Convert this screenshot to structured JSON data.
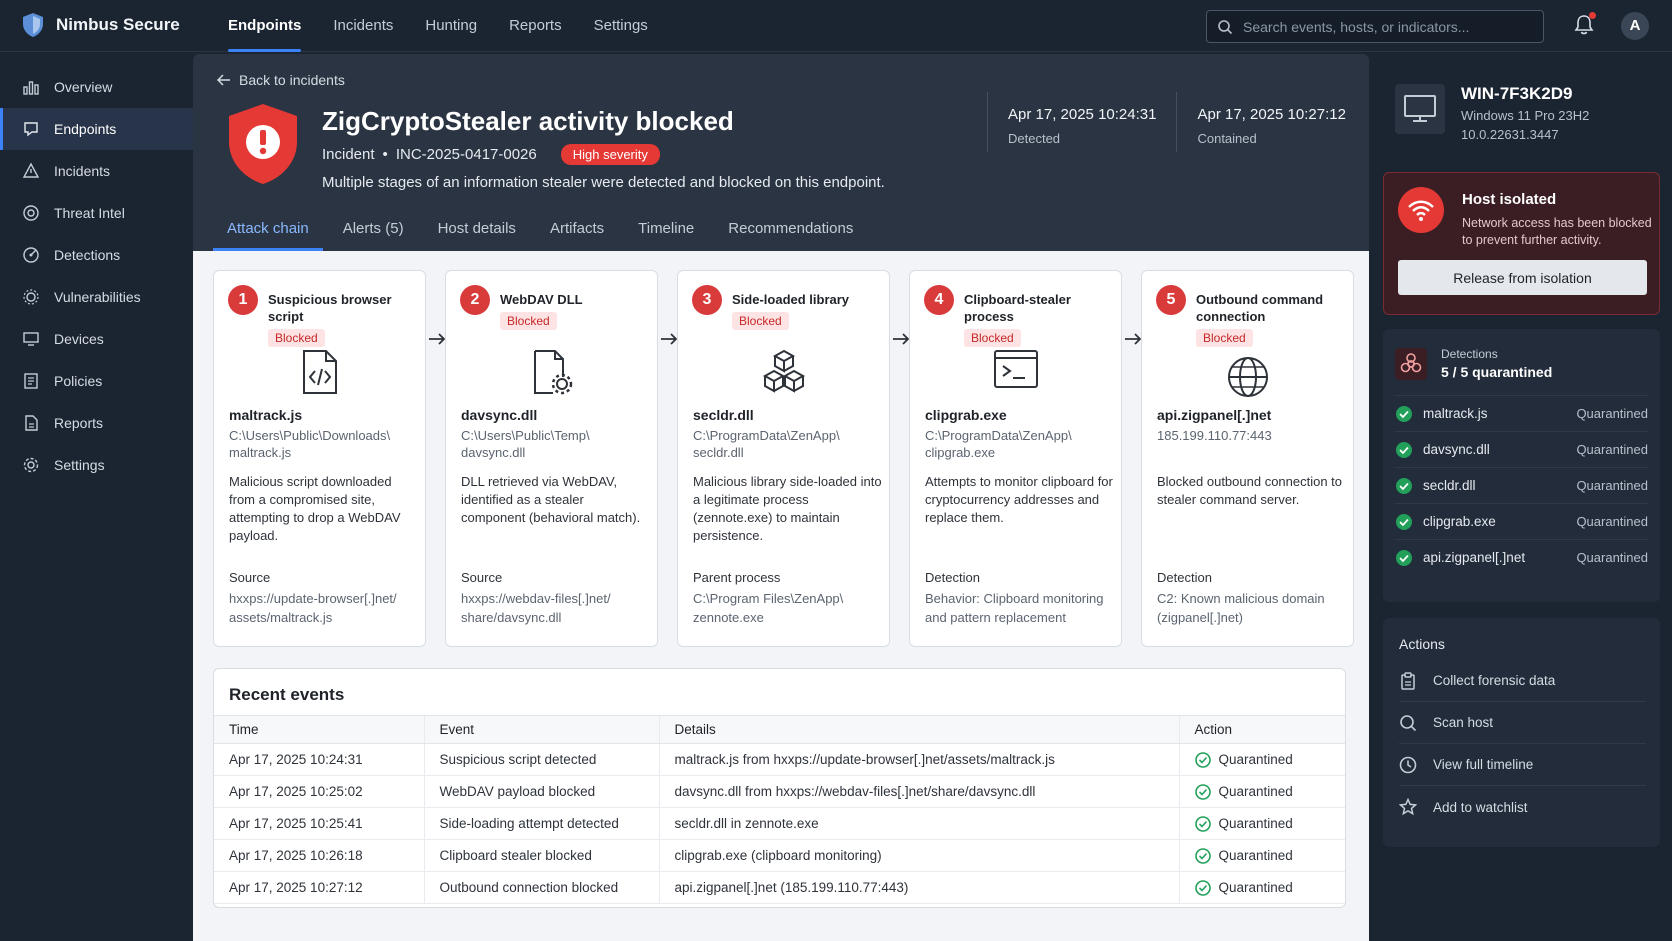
{
  "brand": {
    "name": "Nimbus Secure"
  },
  "topnav": {
    "items": [
      "Endpoints",
      "Incidents",
      "Hunting",
      "Reports",
      "Settings"
    ],
    "active": "Endpoints"
  },
  "search": {
    "placeholder": "Search events, hosts, or indicators..."
  },
  "user": {
    "initial": "A"
  },
  "sidebar": {
    "items": [
      {
        "label": "Overview",
        "icon": "bar-chart-icon"
      },
      {
        "label": "Endpoints",
        "icon": "endpoint-icon",
        "active": true
      },
      {
        "label": "Incidents",
        "icon": "alert-icon"
      },
      {
        "label": "Threat Intel",
        "icon": "globe-target-icon"
      },
      {
        "label": "Detections",
        "icon": "radar-icon"
      },
      {
        "label": "Vulnerabilities",
        "icon": "bug-icon"
      },
      {
        "label": "Devices",
        "icon": "monitor-icon"
      },
      {
        "label": "Policies",
        "icon": "policy-icon"
      },
      {
        "label": "Reports",
        "icon": "report-icon"
      },
      {
        "label": "Settings",
        "icon": "gear-icon"
      }
    ]
  },
  "incident": {
    "back_label": "Back to incidents",
    "title": "ZigCryptoStealer activity blocked",
    "prefix": "Incident",
    "id": "INC-2025-0417-0026",
    "severity": "High severity",
    "description": "Multiple stages of an information stealer were detected and blocked on this endpoint.",
    "detected_time": "Apr 17, 2025  10:24:31",
    "detected_label": "Detected",
    "contained_time": "Apr 17, 2025  10:27:12",
    "contained_label": "Contained"
  },
  "tabs": [
    "Attack chain",
    "Alerts (5)",
    "Host details",
    "Artifacts",
    "Timeline",
    "Recommendations"
  ],
  "steps": [
    {
      "num": "1",
      "title": "Suspicious browser script",
      "status": "Blocked",
      "icon": "code-file-icon",
      "file": "maltrack.js",
      "path": "C:\\Users\\Public\\Downloads\\ maltrack.js",
      "desc": "Malicious script downloaded from a compromised site, attempting to drop a WebDAV payload.",
      "src_label": "Source",
      "src": "hxxps://update-browser[.]net/ assets/maltrack.js"
    },
    {
      "num": "2",
      "title": "WebDAV DLL",
      "status": "Blocked",
      "icon": "file-gear-icon",
      "file": "davsync.dll",
      "path": "C:\\Users\\Public\\Temp\\ davsync.dll",
      "desc": "DLL retrieved via WebDAV, identified as a stealer component (behavioral match).",
      "src_label": "Source",
      "src": "hxxps://webdav-files[.]net/ share/davsync.dll"
    },
    {
      "num": "3",
      "title": "Side-loaded library",
      "status": "Blocked",
      "icon": "cubes-icon",
      "file": "secldr.dll",
      "path": "C:\\ProgramData\\ZenApp\\ secldr.dll",
      "desc": "Malicious library side-loaded into a legitimate process (zennote.exe) to maintain persistence.",
      "src_label": "Parent process",
      "src": "C:\\Program Files\\ZenApp\\ zennote.exe"
    },
    {
      "num": "4",
      "title": "Clipboard-stealer process",
      "status": "Blocked",
      "icon": "terminal-icon",
      "file": "clipgrab.exe",
      "path": "C:\\ProgramData\\ZenApp\\ clipgrab.exe",
      "desc": "Attempts to monitor clipboard for cryptocurrency addresses and replace them.",
      "src_label": "Detection",
      "src": "Behavior: Clipboard monitoring and pattern replacement"
    },
    {
      "num": "5",
      "title": "Outbound command connection",
      "status": "Blocked",
      "icon": "globe-icon",
      "file": "api.zigpanel[.]net",
      "path": "185.199.110.77:443",
      "desc": "Blocked outbound connection to stealer command server.",
      "src_label": "Detection",
      "src": "C2: Known malicious domain (zigpanel[.]net)"
    }
  ],
  "events": {
    "title": "Recent events",
    "columns": [
      "Time",
      "Event",
      "Details",
      "Action"
    ],
    "rows": [
      {
        "time": "Apr 17, 2025  10:24:31",
        "event": "Suspicious script detected",
        "details": "maltrack.js from hxxps://update-browser[.]net/assets/maltrack.js",
        "action": "Quarantined"
      },
      {
        "time": "Apr 17, 2025  10:25:02",
        "event": "WebDAV payload blocked",
        "details": "davsync.dll from hxxps://webdav-files[.]net/share/davsync.dll",
        "action": "Quarantined"
      },
      {
        "time": "Apr 17, 2025  10:25:41",
        "event": "Side-loading attempt detected",
        "details": "secldr.dll in zennote.exe",
        "action": "Quarantined"
      },
      {
        "time": "Apr 17, 2025  10:26:18",
        "event": "Clipboard stealer blocked",
        "details": "clipgrab.exe (clipboard monitoring)",
        "action": "Quarantined"
      },
      {
        "time": "Apr 17, 2025  10:27:12",
        "event": "Outbound connection blocked",
        "details": "api.zigpanel[.]net (185.199.110.77:443)",
        "action": "Quarantined"
      }
    ]
  },
  "host": {
    "name": "WIN-7F3K2D9",
    "os": "Windows 11 Pro 23H2",
    "version": "10.0.22631.3447"
  },
  "isolation": {
    "title": "Host isolated",
    "desc": "Network access has been blocked to prevent further activity.",
    "button": "Release from isolation"
  },
  "detections": {
    "label": "Detections",
    "count": "5 / 5 quarantined",
    "items": [
      {
        "name": "maltrack.js",
        "status": "Quarantined"
      },
      {
        "name": "davsync.dll",
        "status": "Quarantined"
      },
      {
        "name": "secldr.dll",
        "status": "Quarantined"
      },
      {
        "name": "clipgrab.exe",
        "status": "Quarantined"
      },
      {
        "name": "api.zigpanel[.]net",
        "status": "Quarantined"
      }
    ]
  },
  "actions": {
    "title": "Actions",
    "items": [
      {
        "label": "Collect forensic data",
        "icon": "clipboard-icon"
      },
      {
        "label": "Scan host",
        "icon": "search-icon"
      },
      {
        "label": "View full timeline",
        "icon": "clock-icon"
      },
      {
        "label": "Add to watchlist",
        "icon": "star-icon"
      }
    ]
  },
  "colors": {
    "accent": "#3b82f6",
    "danger": "#e53935",
    "success": "#22a05a"
  }
}
